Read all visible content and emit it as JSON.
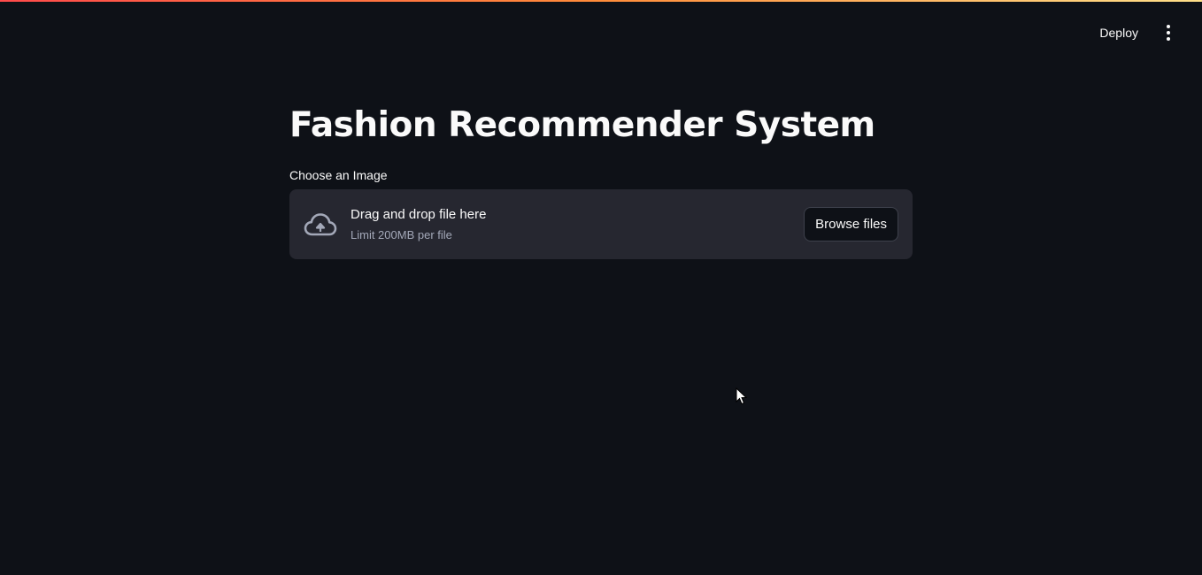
{
  "header": {
    "deploy_label": "Deploy",
    "menu_icon": "vertical-ellipsis-icon"
  },
  "main": {
    "title": "Fashion Recommender System",
    "uploader": {
      "label": "Choose an Image",
      "drop_text": "Drag and drop file here",
      "limit_text": "Limit 200MB per file",
      "browse_label": "Browse files",
      "icon": "cloud-upload-icon"
    }
  },
  "colors": {
    "background": "#0e1117",
    "dropzone": "#262730",
    "text": "#fafafa",
    "muted_text": "#a3a8b8",
    "accent_gradient": [
      "#ff4b4b",
      "#ffe08a"
    ]
  }
}
